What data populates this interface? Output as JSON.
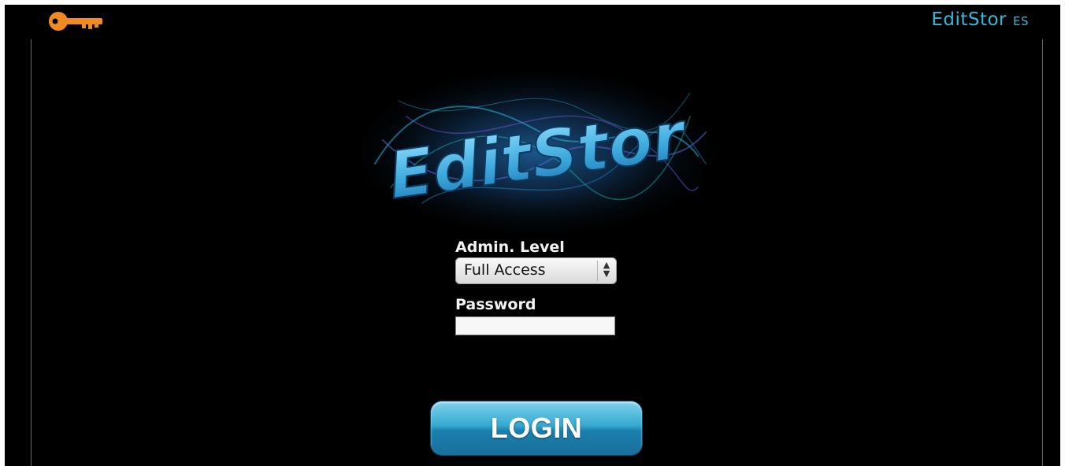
{
  "header": {
    "brand_word": "EditStor",
    "brand_sub": "ES",
    "key_icon": "key-icon"
  },
  "logo": {
    "text": "EditStor",
    "accent": "#3fa9d6"
  },
  "form": {
    "admin_level_label": "Admin. Level",
    "admin_level_value": "Full Access",
    "password_label": "Password",
    "password_value": ""
  },
  "login_button": {
    "label": "LOGIN"
  },
  "colors": {
    "background": "#000000",
    "brand": "#39b6d8",
    "key": "#f08a24",
    "button_top": "#7fd3ec",
    "button_bottom": "#1a6f9a"
  }
}
